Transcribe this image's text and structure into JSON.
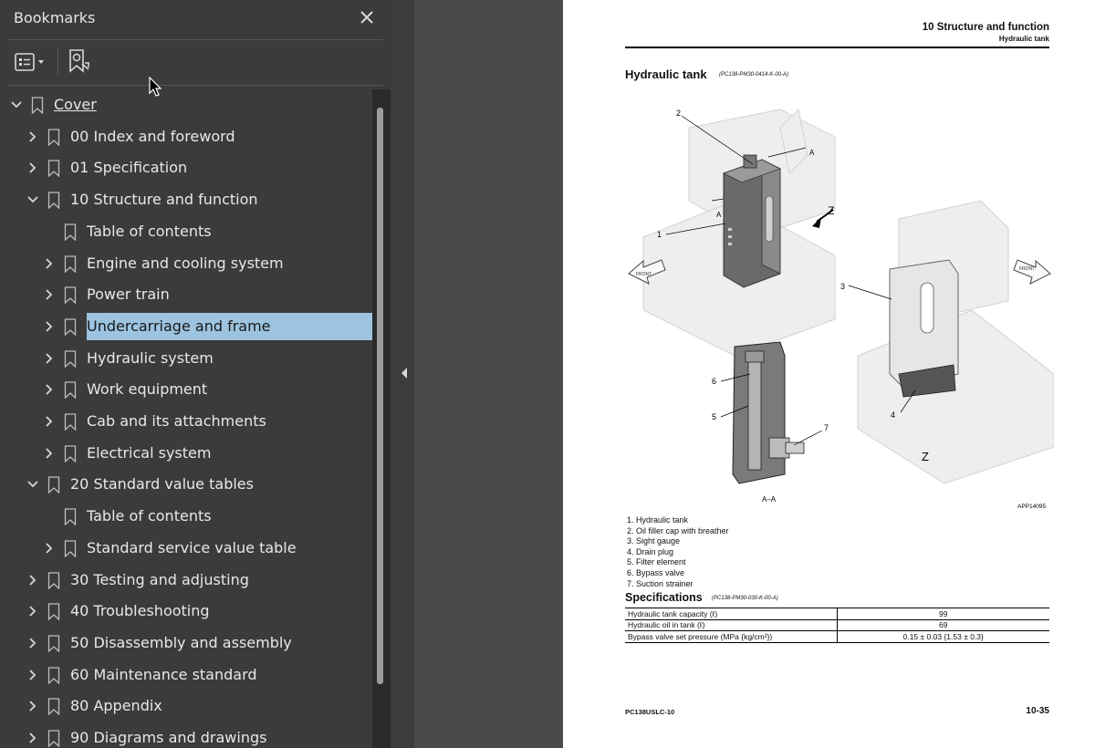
{
  "panel": {
    "title": "Bookmarks",
    "close_icon": "close-icon",
    "options_icon": "list-options-icon",
    "new_bookmark_icon": "new-bookmark-icon"
  },
  "bookmarks": [
    {
      "label": "Cover",
      "level": 0,
      "expander": "expanded",
      "underlined": true
    },
    {
      "label": "00 Index and foreword",
      "level": 1,
      "expander": "collapsed"
    },
    {
      "label": "01 Specification",
      "level": 1,
      "expander": "collapsed"
    },
    {
      "label": "10 Structure and function",
      "level": 1,
      "expander": "expanded"
    },
    {
      "label": "Table of contents",
      "level": 2,
      "expander": "none"
    },
    {
      "label": "Engine and cooling system",
      "level": 2,
      "expander": "collapsed"
    },
    {
      "label": "Power train",
      "level": 2,
      "expander": "collapsed"
    },
    {
      "label": "Undercarriage and frame",
      "level": 2,
      "expander": "collapsed",
      "selected": true
    },
    {
      "label": "Hydraulic system",
      "level": 2,
      "expander": "collapsed"
    },
    {
      "label": "Work equipment",
      "level": 2,
      "expander": "collapsed"
    },
    {
      "label": "Cab and its attachments",
      "level": 2,
      "expander": "collapsed"
    },
    {
      "label": "Electrical system",
      "level": 2,
      "expander": "collapsed"
    },
    {
      "label": "20 Standard value tables",
      "level": 1,
      "expander": "expanded"
    },
    {
      "label": "Table of contents",
      "level": 2,
      "expander": "none"
    },
    {
      "label": "Standard service value table",
      "level": 2,
      "expander": "collapsed"
    },
    {
      "label": "30 Testing and adjusting",
      "level": 1,
      "expander": "collapsed"
    },
    {
      "label": "40 Troubleshooting",
      "level": 1,
      "expander": "collapsed"
    },
    {
      "label": "50 Disassembly and assembly",
      "level": 1,
      "expander": "collapsed"
    },
    {
      "label": "60 Maintenance standard",
      "level": 1,
      "expander": "collapsed"
    },
    {
      "label": "80 Appendix",
      "level": 1,
      "expander": "collapsed"
    },
    {
      "label": "90 Diagrams and drawings",
      "level": 1,
      "expander": "collapsed"
    }
  ],
  "colors": {
    "panel_bg": "#3b3b3b",
    "selection_bg": "#9cc3e0",
    "gutter_bg": "#4a4a4a"
  },
  "document": {
    "header_title": "10 Structure and function",
    "header_subtitle": "Hydraulic tank",
    "section_title": "Hydraulic tank",
    "section_code": "(PC138-PM30-0414-K-00-A)",
    "figure": {
      "callouts": [
        "1",
        "2",
        "3",
        "4",
        "5",
        "6",
        "7"
      ],
      "section_marks": [
        "A",
        "A"
      ],
      "view_label": "Z",
      "view_caption": "Z",
      "section_caption": "A–A",
      "front_label": "FRONT",
      "figure_id": "APP14095"
    },
    "parts": [
      "1.  Hydraulic tank",
      "2.  Oil filler cap with breather",
      "3.  Sight gauge",
      "4.  Drain plug",
      "5.  Filter element",
      "6.  Bypass valve",
      "7.  Suction strainer"
    ],
    "specs_title": "Specifications",
    "specs_code": "(PC138-PM30-030-K-00-A)",
    "specs": [
      {
        "item": "Hydraulic tank capacity (ℓ)",
        "value": "99"
      },
      {
        "item": "Hydraulic oil in tank (ℓ)",
        "value": "69"
      },
      {
        "item": "Bypass valve set pressure (MPa {kg/cm²})",
        "value": "0.15 ± 0.03 {1.53 ± 0.3}"
      }
    ],
    "footer_model": "PC138USLC-10",
    "footer_page": "10-35"
  }
}
